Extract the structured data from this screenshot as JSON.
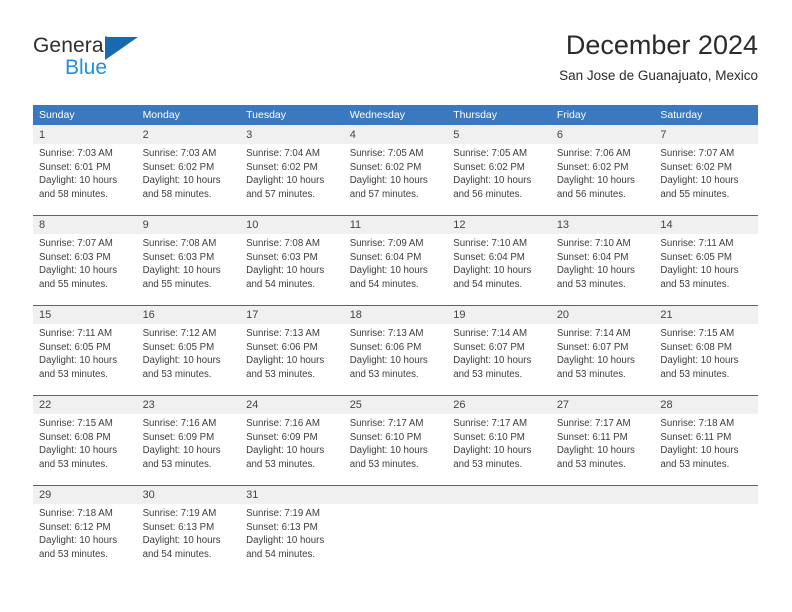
{
  "brand": {
    "name_part1": "General",
    "name_part2": "Blue",
    "triangle_color": "#1769b0",
    "blue_color": "#1f8fe0"
  },
  "header": {
    "title": "December 2024",
    "subtitle": "San Jose de Guanajuato, Mexico"
  },
  "theme": {
    "header_bg": "#3a79bf",
    "daynum_bg": "#f0f0f0",
    "rule_color": "#2f6eb5"
  },
  "weekdays": [
    "Sunday",
    "Monday",
    "Tuesday",
    "Wednesday",
    "Thursday",
    "Friday",
    "Saturday"
  ],
  "weeks": [
    {
      "days": [
        {
          "num": "1",
          "sunrise": "Sunrise: 7:03 AM",
          "sunset": "Sunset: 6:01 PM",
          "daylight1": "Daylight: 10 hours",
          "daylight2": "and 58 minutes."
        },
        {
          "num": "2",
          "sunrise": "Sunrise: 7:03 AM",
          "sunset": "Sunset: 6:02 PM",
          "daylight1": "Daylight: 10 hours",
          "daylight2": "and 58 minutes."
        },
        {
          "num": "3",
          "sunrise": "Sunrise: 7:04 AM",
          "sunset": "Sunset: 6:02 PM",
          "daylight1": "Daylight: 10 hours",
          "daylight2": "and 57 minutes."
        },
        {
          "num": "4",
          "sunrise": "Sunrise: 7:05 AM",
          "sunset": "Sunset: 6:02 PM",
          "daylight1": "Daylight: 10 hours",
          "daylight2": "and 57 minutes."
        },
        {
          "num": "5",
          "sunrise": "Sunrise: 7:05 AM",
          "sunset": "Sunset: 6:02 PM",
          "daylight1": "Daylight: 10 hours",
          "daylight2": "and 56 minutes."
        },
        {
          "num": "6",
          "sunrise": "Sunrise: 7:06 AM",
          "sunset": "Sunset: 6:02 PM",
          "daylight1": "Daylight: 10 hours",
          "daylight2": "and 56 minutes."
        },
        {
          "num": "7",
          "sunrise": "Sunrise: 7:07 AM",
          "sunset": "Sunset: 6:02 PM",
          "daylight1": "Daylight: 10 hours",
          "daylight2": "and 55 minutes."
        }
      ]
    },
    {
      "days": [
        {
          "num": "8",
          "sunrise": "Sunrise: 7:07 AM",
          "sunset": "Sunset: 6:03 PM",
          "daylight1": "Daylight: 10 hours",
          "daylight2": "and 55 minutes."
        },
        {
          "num": "9",
          "sunrise": "Sunrise: 7:08 AM",
          "sunset": "Sunset: 6:03 PM",
          "daylight1": "Daylight: 10 hours",
          "daylight2": "and 55 minutes."
        },
        {
          "num": "10",
          "sunrise": "Sunrise: 7:08 AM",
          "sunset": "Sunset: 6:03 PM",
          "daylight1": "Daylight: 10 hours",
          "daylight2": "and 54 minutes."
        },
        {
          "num": "11",
          "sunrise": "Sunrise: 7:09 AM",
          "sunset": "Sunset: 6:04 PM",
          "daylight1": "Daylight: 10 hours",
          "daylight2": "and 54 minutes."
        },
        {
          "num": "12",
          "sunrise": "Sunrise: 7:10 AM",
          "sunset": "Sunset: 6:04 PM",
          "daylight1": "Daylight: 10 hours",
          "daylight2": "and 54 minutes."
        },
        {
          "num": "13",
          "sunrise": "Sunrise: 7:10 AM",
          "sunset": "Sunset: 6:04 PM",
          "daylight1": "Daylight: 10 hours",
          "daylight2": "and 53 minutes."
        },
        {
          "num": "14",
          "sunrise": "Sunrise: 7:11 AM",
          "sunset": "Sunset: 6:05 PM",
          "daylight1": "Daylight: 10 hours",
          "daylight2": "and 53 minutes."
        }
      ]
    },
    {
      "days": [
        {
          "num": "15",
          "sunrise": "Sunrise: 7:11 AM",
          "sunset": "Sunset: 6:05 PM",
          "daylight1": "Daylight: 10 hours",
          "daylight2": "and 53 minutes."
        },
        {
          "num": "16",
          "sunrise": "Sunrise: 7:12 AM",
          "sunset": "Sunset: 6:05 PM",
          "daylight1": "Daylight: 10 hours",
          "daylight2": "and 53 minutes."
        },
        {
          "num": "17",
          "sunrise": "Sunrise: 7:13 AM",
          "sunset": "Sunset: 6:06 PM",
          "daylight1": "Daylight: 10 hours",
          "daylight2": "and 53 minutes."
        },
        {
          "num": "18",
          "sunrise": "Sunrise: 7:13 AM",
          "sunset": "Sunset: 6:06 PM",
          "daylight1": "Daylight: 10 hours",
          "daylight2": "and 53 minutes."
        },
        {
          "num": "19",
          "sunrise": "Sunrise: 7:14 AM",
          "sunset": "Sunset: 6:07 PM",
          "daylight1": "Daylight: 10 hours",
          "daylight2": "and 53 minutes."
        },
        {
          "num": "20",
          "sunrise": "Sunrise: 7:14 AM",
          "sunset": "Sunset: 6:07 PM",
          "daylight1": "Daylight: 10 hours",
          "daylight2": "and 53 minutes."
        },
        {
          "num": "21",
          "sunrise": "Sunrise: 7:15 AM",
          "sunset": "Sunset: 6:08 PM",
          "daylight1": "Daylight: 10 hours",
          "daylight2": "and 53 minutes."
        }
      ]
    },
    {
      "days": [
        {
          "num": "22",
          "sunrise": "Sunrise: 7:15 AM",
          "sunset": "Sunset: 6:08 PM",
          "daylight1": "Daylight: 10 hours",
          "daylight2": "and 53 minutes."
        },
        {
          "num": "23",
          "sunrise": "Sunrise: 7:16 AM",
          "sunset": "Sunset: 6:09 PM",
          "daylight1": "Daylight: 10 hours",
          "daylight2": "and 53 minutes."
        },
        {
          "num": "24",
          "sunrise": "Sunrise: 7:16 AM",
          "sunset": "Sunset: 6:09 PM",
          "daylight1": "Daylight: 10 hours",
          "daylight2": "and 53 minutes."
        },
        {
          "num": "25",
          "sunrise": "Sunrise: 7:17 AM",
          "sunset": "Sunset: 6:10 PM",
          "daylight1": "Daylight: 10 hours",
          "daylight2": "and 53 minutes."
        },
        {
          "num": "26",
          "sunrise": "Sunrise: 7:17 AM",
          "sunset": "Sunset: 6:10 PM",
          "daylight1": "Daylight: 10 hours",
          "daylight2": "and 53 minutes."
        },
        {
          "num": "27",
          "sunrise": "Sunrise: 7:17 AM",
          "sunset": "Sunset: 6:11 PM",
          "daylight1": "Daylight: 10 hours",
          "daylight2": "and 53 minutes."
        },
        {
          "num": "28",
          "sunrise": "Sunrise: 7:18 AM",
          "sunset": "Sunset: 6:11 PM",
          "daylight1": "Daylight: 10 hours",
          "daylight2": "and 53 minutes."
        }
      ]
    },
    {
      "days": [
        {
          "num": "29",
          "sunrise": "Sunrise: 7:18 AM",
          "sunset": "Sunset: 6:12 PM",
          "daylight1": "Daylight: 10 hours",
          "daylight2": "and 53 minutes."
        },
        {
          "num": "30",
          "sunrise": "Sunrise: 7:19 AM",
          "sunset": "Sunset: 6:13 PM",
          "daylight1": "Daylight: 10 hours",
          "daylight2": "and 54 minutes."
        },
        {
          "num": "31",
          "sunrise": "Sunrise: 7:19 AM",
          "sunset": "Sunset: 6:13 PM",
          "daylight1": "Daylight: 10 hours",
          "daylight2": "and 54 minutes."
        },
        {
          "num": "",
          "sunrise": "",
          "sunset": "",
          "daylight1": "",
          "daylight2": ""
        },
        {
          "num": "",
          "sunrise": "",
          "sunset": "",
          "daylight1": "",
          "daylight2": ""
        },
        {
          "num": "",
          "sunrise": "",
          "sunset": "",
          "daylight1": "",
          "daylight2": ""
        },
        {
          "num": "",
          "sunrise": "",
          "sunset": "",
          "daylight1": "",
          "daylight2": ""
        }
      ]
    }
  ]
}
